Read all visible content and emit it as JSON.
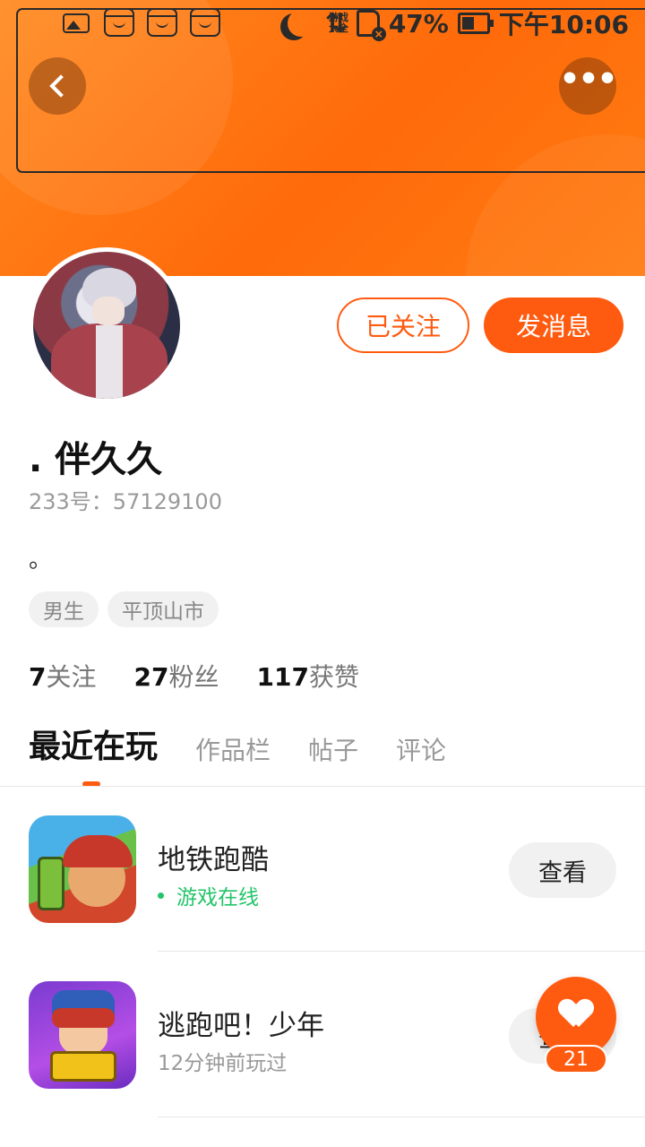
{
  "status_bar": {
    "app_icon_game_label": "游戏\n大全",
    "battery": "47%",
    "time": "下午10:06"
  },
  "header": {
    "back_icon": "chevron-left-icon",
    "more_icon": "more-horizontal-icon",
    "accent_color": "#ff5b10"
  },
  "profile": {
    "name": ". 伴久久",
    "id_text": "233号：57129100",
    "bio": "。",
    "tags": [
      "男生",
      "平顶山市"
    ],
    "follow_button": "已关注",
    "message_button": "发消息",
    "stats": [
      {
        "num": "7",
        "label": "关注"
      },
      {
        "num": "27",
        "label": "粉丝"
      },
      {
        "num": "117",
        "label": "获赞"
      }
    ]
  },
  "tabs": [
    "最近在玩",
    "作品栏",
    "帖子",
    "评论"
  ],
  "games": [
    {
      "title": "地铁跑酷",
      "status": "游戏在线",
      "button": "查看"
    },
    {
      "title": "逃跑吧！少年",
      "status": "12分钟前玩过",
      "button": "查看"
    }
  ],
  "like_fab": {
    "count": "21"
  }
}
